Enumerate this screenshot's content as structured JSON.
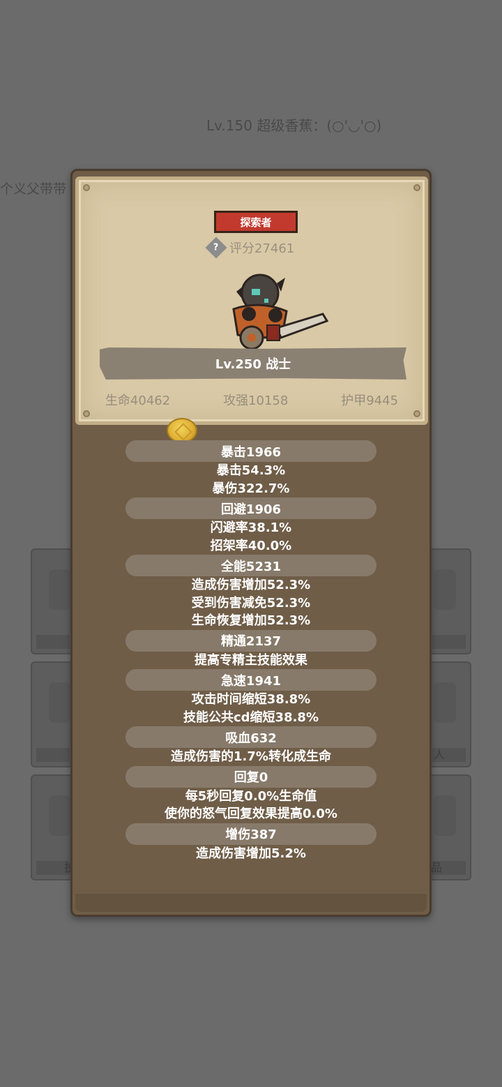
{
  "background": {
    "title": "Lv.150 超级香蕉：(○'◡'○)",
    "left_text": "个义父带带",
    "card_labels": [
      "人",
      "品",
      "技"
    ]
  },
  "panel": {
    "title_badge": "探索者",
    "score": "评分27461",
    "hero_name": "Lv.250 战士",
    "stats": {
      "hp": "生命40462",
      "attack": "攻强10158",
      "armor": "护甲9445"
    }
  },
  "attributes": [
    {
      "head": "暴击1966",
      "lines": [
        "暴击54.3%",
        "暴伤322.7%"
      ]
    },
    {
      "head": "回避1906",
      "lines": [
        "闪避率38.1%",
        "招架率40.0%"
      ]
    },
    {
      "head": "全能5231",
      "lines": [
        "造成伤害增加52.3%",
        "受到伤害减免52.3%",
        "生命恢复增加52.3%"
      ]
    },
    {
      "head": "精通2137",
      "lines": [
        "提高专精主技能效果"
      ]
    },
    {
      "head": "急速1941",
      "lines": [
        "攻击时间缩短38.8%",
        "技能公共cd缩短38.8%"
      ]
    },
    {
      "head": "吸血632",
      "lines": [
        "造成伤害的1.7%转化成生命"
      ]
    },
    {
      "head": "回复0",
      "lines": [
        "每5秒回复0.0%生命值",
        "使你的怒气回复效果提高0.0%"
      ]
    },
    {
      "head": "增伤387",
      "lines": [
        "造成伤害增加5.2%"
      ]
    }
  ],
  "colors": {
    "badge": "#c23a2e",
    "panel": "#6f5d48",
    "parchment": "#d9c9a6"
  }
}
